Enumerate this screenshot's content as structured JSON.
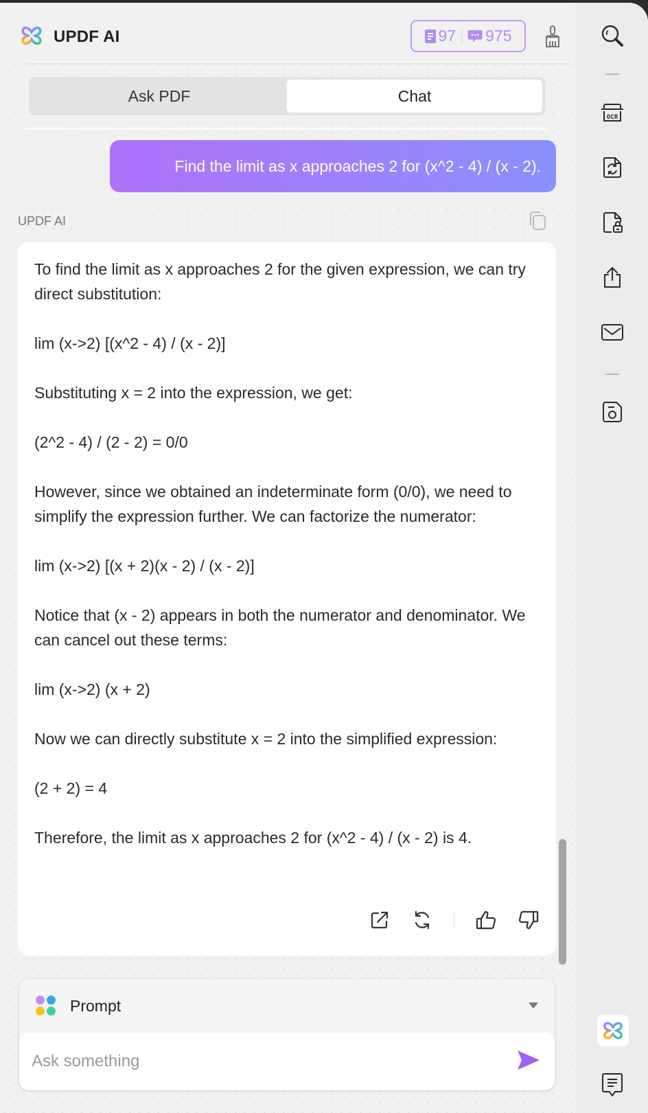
{
  "header": {
    "title": "UPDF AI",
    "badges": [
      {
        "icon": "document-icon",
        "value": "97"
      },
      {
        "icon": "chat-bubble-icon",
        "value": "975"
      }
    ],
    "clear_icon": "broom-icon"
  },
  "tabs": [
    {
      "label": "Ask PDF",
      "active": false
    },
    {
      "label": "Chat",
      "active": true
    }
  ],
  "conversation": {
    "user_message": "Find the limit as x approaches 2 for (x^2 - 4) / (x - 2).",
    "ai_label": "UPDF AI",
    "answer_paragraphs": [
      "To find the limit as x approaches 2 for the given expression, we can try direct substitution:",
      "lim (x->2) [(x^2 - 4) / (x - 2)]",
      "Substituting x = 2 into the expression, we get:",
      "(2^2 - 4) / (2 - 2) = 0/0",
      "However, since we obtained an indeterminate form (0/0), we need to simplify the expression further. We can factorize the numerator:",
      "lim (x->2) [(x + 2)(x - 2) / (x - 2)]",
      "Notice that (x - 2) appears in both the numerator and denominator. We can cancel out these terms:",
      "lim (x->2) (x + 2)",
      "Now we can directly substitute x = 2 into the simplified expression:",
      "(2 + 2) = 4",
      "Therefore, the limit as x approaches 2 for (x^2 - 4) / (x - 2) is 4."
    ],
    "actions": [
      "export-icon",
      "regenerate-icon",
      "thumbs-up-icon",
      "thumbs-down-icon"
    ]
  },
  "composer": {
    "prompt_label": "Prompt",
    "input_placeholder": "Ask something",
    "input_value": ""
  },
  "sidebar": {
    "icons": [
      "search-icon",
      "ocr-icon",
      "convert-icon",
      "protect-icon",
      "share-icon",
      "mail-icon",
      "save-icon",
      "updf-ai-icon",
      "comment-icon"
    ]
  },
  "colors": {
    "accent": "#a56ff8",
    "bubble_start": "#ae72fa",
    "bubble_end": "#8890fb",
    "badge_border": "#c39bf3"
  }
}
